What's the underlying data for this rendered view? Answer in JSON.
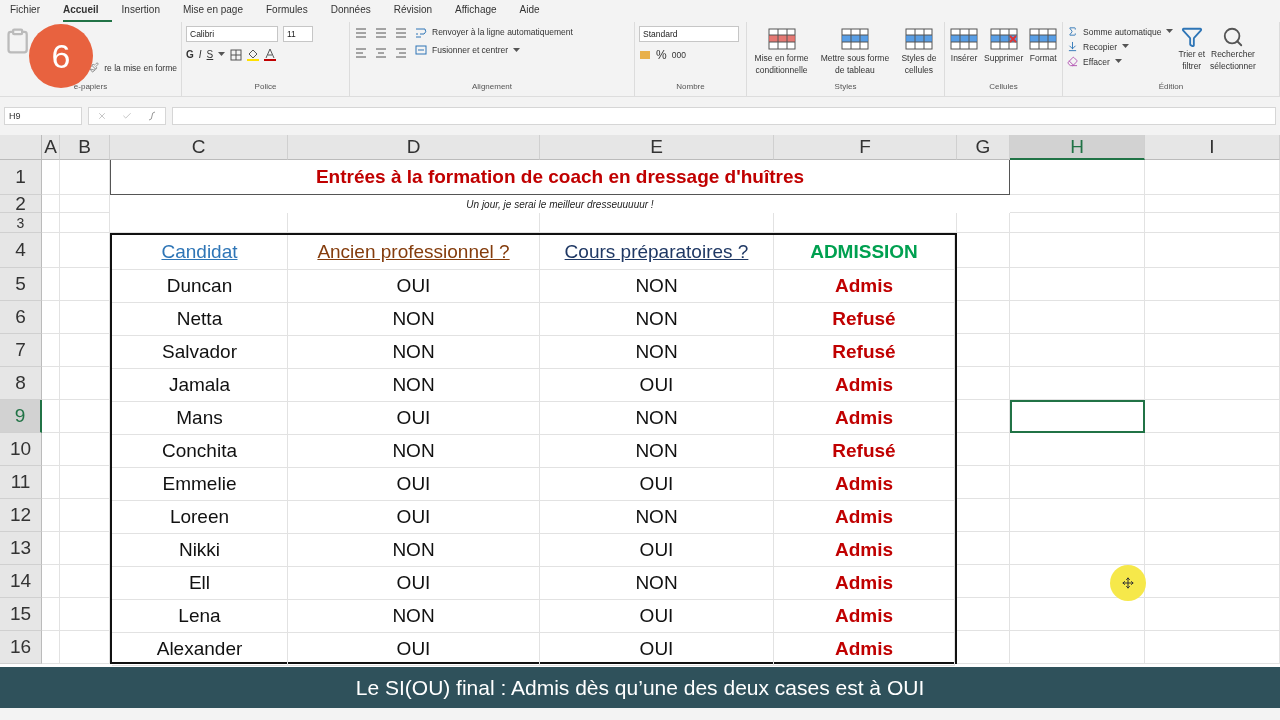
{
  "ribbon_tabs": [
    {
      "label": "Fichier",
      "selected": false
    },
    {
      "label": "Accueil",
      "selected": true
    },
    {
      "label": "Insertion",
      "selected": false
    },
    {
      "label": "Mise en page",
      "selected": false
    },
    {
      "label": "Formules",
      "selected": false
    },
    {
      "label": "Données",
      "selected": false
    },
    {
      "label": "Révision",
      "selected": false
    },
    {
      "label": "Affichage",
      "selected": false
    },
    {
      "label": "Aide",
      "selected": false
    }
  ],
  "step_badge": "6",
  "clipboard": {
    "format_painter": "re la mise en forme",
    "group_label": "e-papiers"
  },
  "font": {
    "name": "Calibri",
    "size": "11",
    "bold": "G",
    "italic": "I",
    "underline": "S",
    "group_label": "Police"
  },
  "alignment": {
    "wrap": "Renvoyer à la ligne automatiquement",
    "merge": "Fusionner et centrer",
    "group_label": "Alignement"
  },
  "number": {
    "format": "Standard",
    "percent": "%",
    "thousands": "000",
    "group_label": "Nombre"
  },
  "styles": {
    "buttons": [
      {
        "kind": "conditional",
        "lines": [
          "Mise en forme",
          "conditionnelle"
        ]
      },
      {
        "kind": "table",
        "lines": [
          "Mettre sous forme",
          "de tableau"
        ]
      },
      {
        "kind": "cellstyle",
        "lines": [
          "Styles de",
          "cellules"
        ]
      }
    ],
    "group_label": "Styles"
  },
  "cells": {
    "buttons": [
      {
        "kind": "insert",
        "label": "Insérer"
      },
      {
        "kind": "delete",
        "label": "Supprimer"
      },
      {
        "kind": "format",
        "label": "Format"
      }
    ],
    "group_label": "Cellules"
  },
  "editing": {
    "items": [
      {
        "kind": "sum",
        "label": "Somme automatique"
      },
      {
        "kind": "fill",
        "label": "Recopier"
      },
      {
        "kind": "clear",
        "label": "Effacer"
      }
    ],
    "sort": [
      "Trier et",
      "filtrer"
    ],
    "find": [
      "Rechercher",
      "sélectionner"
    ],
    "group_label": "Édition"
  },
  "formula_bar": {
    "name_box": "H9"
  },
  "sheet": {
    "columns": [
      {
        "label": "A",
        "selected": false
      },
      {
        "label": "B",
        "selected": false
      },
      {
        "label": "C",
        "selected": false
      },
      {
        "label": "D",
        "selected": false
      },
      {
        "label": "E",
        "selected": false
      },
      {
        "label": "F",
        "selected": false
      },
      {
        "label": "G",
        "selected": false
      },
      {
        "label": "H",
        "selected": true
      },
      {
        "label": "I",
        "selected": false
      }
    ],
    "rows": [
      {
        "label": "1",
        "selected": false
      },
      {
        "label": "2",
        "selected": false
      },
      {
        "label": "3",
        "selected": false
      },
      {
        "label": "4",
        "selected": false
      },
      {
        "label": "5",
        "selected": false
      },
      {
        "label": "6",
        "selected": false
      },
      {
        "label": "7",
        "selected": false
      },
      {
        "label": "8",
        "selected": false
      },
      {
        "label": "9",
        "selected": true
      },
      {
        "label": "10",
        "selected": false
      },
      {
        "label": "11",
        "selected": false
      },
      {
        "label": "12",
        "selected": false
      },
      {
        "label": "13",
        "selected": false
      },
      {
        "label": "14",
        "selected": false
      },
      {
        "label": "15",
        "selected": false
      },
      {
        "label": "16",
        "selected": false
      }
    ],
    "title": "Entrées à la formation de coach en dressage d'huîtres",
    "subtitle": "Un jour, je serai le meilleur dresseuuuuur !",
    "table": {
      "headers": [
        {
          "label": "Candidat",
          "color": "#2e75b6"
        },
        {
          "label": "Ancien professionnel ?",
          "color": "#843c0c"
        },
        {
          "label": "Cours préparatoires ?",
          "color": "#1f3864"
        },
        {
          "label": "ADMISSION",
          "color": "#00a050"
        }
      ],
      "rows": [
        {
          "cells": [
            "Duncan",
            "OUI",
            "NON"
          ],
          "admission": "Admis"
        },
        {
          "cells": [
            "Netta",
            "NON",
            "NON"
          ],
          "admission": "Refusé"
        },
        {
          "cells": [
            "Salvador",
            "NON",
            "NON"
          ],
          "admission": "Refusé"
        },
        {
          "cells": [
            "Jamala",
            "NON",
            "OUI"
          ],
          "admission": "Admis"
        },
        {
          "cells": [
            "Mans",
            "OUI",
            "NON"
          ],
          "admission": "Admis"
        },
        {
          "cells": [
            "Conchita",
            "NON",
            "NON"
          ],
          "admission": "Refusé"
        },
        {
          "cells": [
            "Emmelie",
            "OUI",
            "OUI"
          ],
          "admission": "Admis"
        },
        {
          "cells": [
            "Loreen",
            "OUI",
            "NON"
          ],
          "admission": "Admis"
        },
        {
          "cells": [
            "Nikki",
            "NON",
            "OUI"
          ],
          "admission": "Admis"
        },
        {
          "cells": [
            "Ell",
            "OUI",
            "NON"
          ],
          "admission": "Admis"
        },
        {
          "cells": [
            "Lena",
            "NON",
            "OUI"
          ],
          "admission": "Admis"
        },
        {
          "cells": [
            "Alexander",
            "OUI",
            "OUI"
          ],
          "admission": "Admis"
        }
      ]
    }
  },
  "caption": "Le SI(OU) final : Admis dès qu’une des deux cases est à OUI"
}
